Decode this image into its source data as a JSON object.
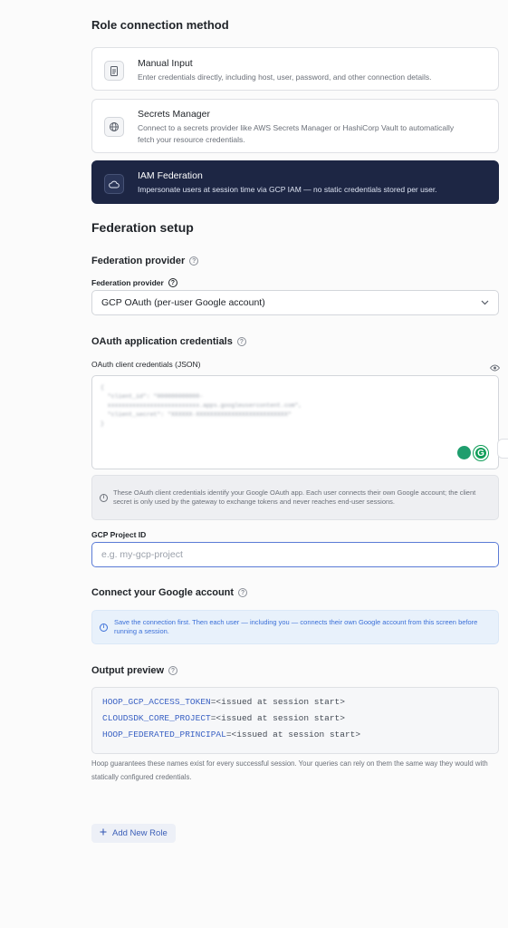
{
  "role_section": {
    "title": "Role connection method",
    "options": [
      {
        "title": "Manual Input",
        "desc": "Enter credentials directly, including host, user, password, and other connection details.",
        "icon": "document-icon"
      },
      {
        "title": "Secrets Manager",
        "desc": "Connect to a secrets provider like AWS Secrets Manager or HashiCorp Vault to automatically fetch your resource credentials.",
        "icon": "globe-lock-icon"
      },
      {
        "title": "IAM Federation",
        "desc": "Impersonate users at session time via GCP IAM — no static credentials stored per user.",
        "icon": "cloud-icon",
        "selected": true
      }
    ]
  },
  "federation": {
    "title": "Federation setup",
    "provider_heading": "Federation provider",
    "provider_label": "Federation provider",
    "provider_value": "GCP OAuth (per-user Google account)",
    "oauth_heading": "OAuth application credentials",
    "oauth_label": "OAuth client credentials (JSON)",
    "oauth_note": "These OAuth client credentials identify your Google OAuth app. Each user connects their own Google account; the client secret is only used by the gateway to exchange tokens and never reaches end-user sessions.",
    "project_label": "GCP Project ID",
    "project_placeholder": "e.g. my-gcp-project",
    "connect_heading": "Connect your Google account",
    "connect_note": "Save the connection first. Then each user — including you — connects their own Google account from this screen before running a session.",
    "output_heading": "Output preview",
    "output_lines": [
      {
        "key": "HOOP_GCP_ACCESS_TOKEN",
        "value": "=<issued at session start>"
      },
      {
        "key": "CLOUDSDK_CORE_PROJECT",
        "value": "=<issued at session start>"
      },
      {
        "key": "HOOP_FEDERATED_PRINCIPAL",
        "value": "=<issued at session start>"
      }
    ],
    "footnote": "Hoop guarantees these names exist for every successful session. Your queries can rely on them the same way they would with statically configured credentials.",
    "add_role_label": "Add New Role"
  },
  "colors": {
    "selected_card": "#1d2644",
    "accent": "#3c5fb8",
    "info_blue": "#3a6fd8"
  }
}
